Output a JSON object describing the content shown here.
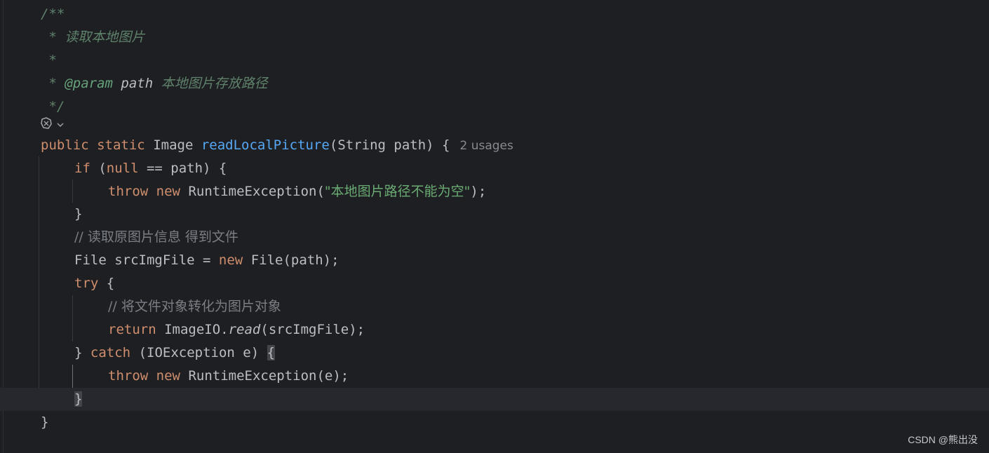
{
  "editor": {
    "language": "java",
    "theme_colors": {
      "background": "#1e1f22",
      "current_line": "#26282e",
      "keyword": "#cf8e6d",
      "function": "#56a8f5",
      "string": "#6aab73",
      "comment": "#7a7e85",
      "doc_comment": "#5f826b",
      "default_text": "#bcbec4"
    },
    "code": {
      "doc_open": "/**",
      "doc_star": " * ",
      "doc_desc": "读取本地图片",
      "doc_blank": " *",
      "doc_param_tag": "@param",
      "doc_param_name": "path",
      "doc_param_desc": "本地图片存放路径",
      "doc_close": " */",
      "kw_public": "public",
      "kw_static": "static",
      "type_image": "Image",
      "method_name": "readLocalPicture",
      "params": "(String path) {",
      "usages": "2 usages",
      "kw_if": "if",
      "if_open": " (",
      "kw_null": "null",
      "if_rest": " == path) {",
      "kw_throw": "throw",
      "kw_new": "new",
      "runtime_exception_open": "RuntimeException(",
      "error_string": "\"本地图片路径不能为空\"",
      "stmt_end": ");",
      "close_brace": "}",
      "comment_read": "// 读取原图片信息 得到文件",
      "file_decl": "File srcImgFile = ",
      "file_ctor": "File(path);",
      "kw_try": "try",
      "open_brace": "{",
      "comment_convert": "// 将文件对象转化为图片对象",
      "kw_return": "return",
      "imageio": "ImageIO.",
      "read_method": "read",
      "read_args": "(srcImgFile);",
      "kw_catch": "catch",
      "catch_params": "(IOException e) ",
      "runtime_exception_e": "RuntimeException(e);"
    },
    "gutter_icons": [
      "ai-assistant-icon",
      "chevron-down-icon"
    ]
  },
  "watermark": "CSDN @熊出没"
}
